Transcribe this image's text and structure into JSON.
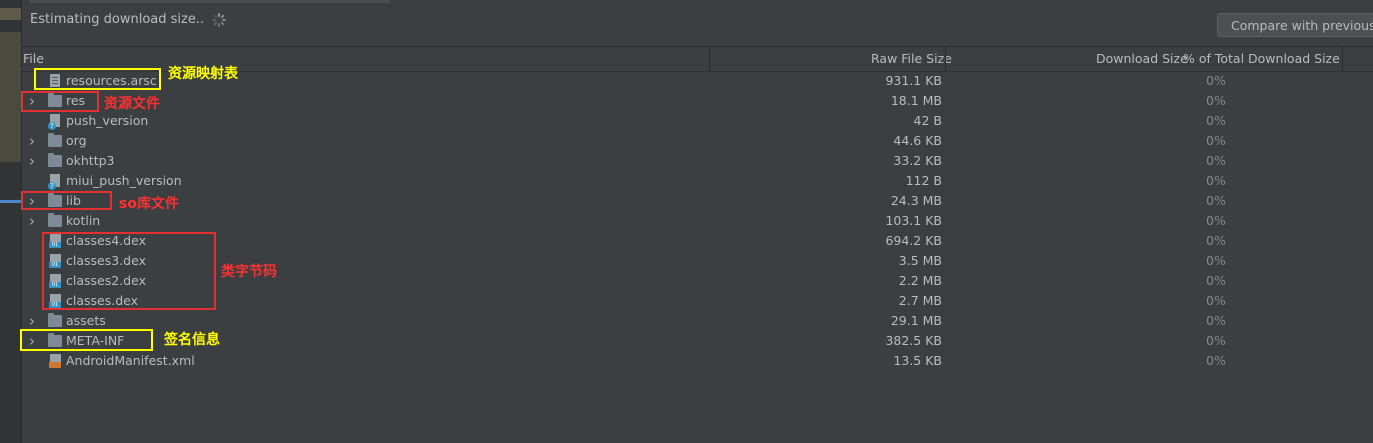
{
  "toolbar": {
    "status_text": "Estimating download size..",
    "compare_button_label": "Compare with previous APK..."
  },
  "table": {
    "headers": {
      "file": "File",
      "raw_size": "Raw File Size",
      "download_size": "Download Size",
      "percent": "% of Total Download Size"
    },
    "rows": [
      {
        "name": "resources.arsc",
        "size": "931.1 KB",
        "pct": "0%",
        "type": "file",
        "expandable": false
      },
      {
        "name": "res",
        "size": "18.1 MB",
        "pct": "0%",
        "type": "folder",
        "expandable": true
      },
      {
        "name": "push_version",
        "size": "42 B",
        "pct": "0%",
        "type": "unknown",
        "expandable": false
      },
      {
        "name": "org",
        "size": "44.6 KB",
        "pct": "0%",
        "type": "folder",
        "expandable": true
      },
      {
        "name": "okhttp3",
        "size": "33.2 KB",
        "pct": "0%",
        "type": "folder",
        "expandable": true
      },
      {
        "name": "miui_push_version",
        "size": "112 B",
        "pct": "0%",
        "type": "unknown",
        "expandable": false
      },
      {
        "name": "lib",
        "size": "24.3 MB",
        "pct": "0%",
        "type": "folder",
        "expandable": true
      },
      {
        "name": "kotlin",
        "size": "103.1 KB",
        "pct": "0%",
        "type": "folder",
        "expandable": true
      },
      {
        "name": "classes4.dex",
        "size": "694.2 KB",
        "pct": "0%",
        "type": "dex",
        "expandable": false
      },
      {
        "name": "classes3.dex",
        "size": "3.5 MB",
        "pct": "0%",
        "type": "dex",
        "expandable": false
      },
      {
        "name": "classes2.dex",
        "size": "2.2 MB",
        "pct": "0%",
        "type": "dex",
        "expandable": false
      },
      {
        "name": "classes.dex",
        "size": "2.7 MB",
        "pct": "0%",
        "type": "dex",
        "expandable": false
      },
      {
        "name": "assets",
        "size": "29.1 MB",
        "pct": "0%",
        "type": "folder",
        "expandable": true
      },
      {
        "name": "META-INF",
        "size": "382.5 KB",
        "pct": "0%",
        "type": "folder",
        "expandable": true
      },
      {
        "name": "AndroidManifest.xml",
        "size": "13.5 KB",
        "pct": "0%",
        "type": "xml",
        "expandable": false
      }
    ]
  },
  "annotations": {
    "resources_arsc": "资源映射表",
    "res": "资源文件",
    "lib": "so库文件",
    "dex": "类字节码",
    "meta_inf": "签名信息"
  },
  "colors": {
    "annotation_yellow": "#ffff00",
    "annotation_red": "#e03030",
    "background": "#3c3f41"
  },
  "icons": {
    "folder": "folder-icon",
    "file": "file-icon",
    "dex": "dex-file-icon",
    "xml": "xml-file-icon",
    "unknown": "unknown-file-icon",
    "expand": "chevron-right-icon"
  }
}
